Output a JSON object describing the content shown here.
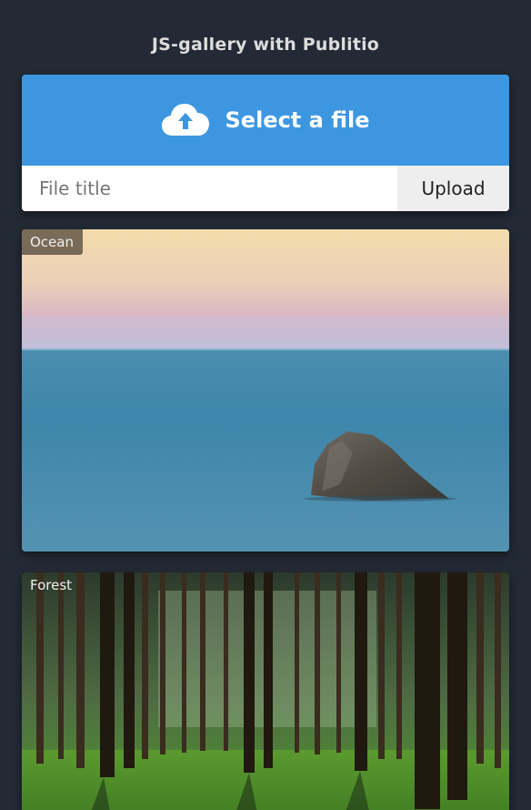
{
  "app": {
    "title": "JS-gallery with Publitio"
  },
  "uploader": {
    "select_label": "Select a file",
    "select_icon": "cloud-upload-icon",
    "title_placeholder": "File title",
    "title_value": "",
    "upload_label": "Upload",
    "accent_color": "#3d97e0"
  },
  "gallery": {
    "items": [
      {
        "title": "Ocean"
      },
      {
        "title": "Forest"
      }
    ]
  }
}
